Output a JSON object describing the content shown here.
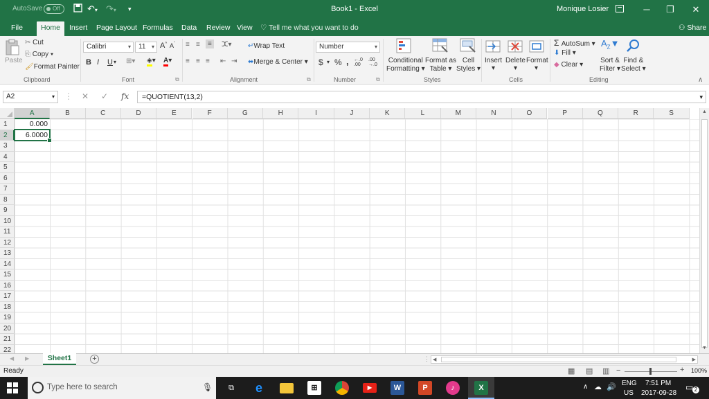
{
  "titlebar": {
    "autosave_label": "AutoSave",
    "autosave_state": "Off",
    "doc_title": "Book1  -  Excel",
    "user": "Monique Losier"
  },
  "tabs": [
    "File",
    "Home",
    "Insert",
    "Page Layout",
    "Formulas",
    "Data",
    "Review",
    "View"
  ],
  "active_tab": "Home",
  "tell_me": "Tell me what you want to do",
  "share": "Share",
  "ribbon": {
    "clipboard": {
      "paste": "Paste",
      "cut": "Cut",
      "copy": "Copy",
      "format_painter": "Format Painter",
      "label": "Clipboard"
    },
    "font": {
      "name": "Calibri",
      "size": "11",
      "bold": "B",
      "italic": "I",
      "underline": "U",
      "label": "Font"
    },
    "alignment": {
      "wrap": "Wrap Text",
      "merge": "Merge & Center",
      "label": "Alignment"
    },
    "number": {
      "format": "Number",
      "currency": "$",
      "percent": "%",
      "comma": ",",
      "label": "Number"
    },
    "styles": {
      "conditional": [
        "Conditional",
        "Formatting"
      ],
      "format_table": [
        "Format as",
        "Table"
      ],
      "cell_styles": [
        "Cell",
        "Styles"
      ],
      "label": "Styles"
    },
    "cells": {
      "insert": "Insert",
      "delete": "Delete",
      "format": "Format",
      "label": "Cells"
    },
    "editing": {
      "autosum": "AutoSum",
      "fill": "Fill",
      "clear": "Clear",
      "sort": [
        "Sort &",
        "Filter"
      ],
      "find": [
        "Find &",
        "Select"
      ],
      "label": "Editing"
    }
  },
  "formula_bar": {
    "name_box": "A2",
    "fx": "fx",
    "formula": "=QUOTIENT(13,2)"
  },
  "columns": [
    "A",
    "B",
    "C",
    "D",
    "E",
    "F",
    "G",
    "H",
    "I",
    "J",
    "K",
    "L",
    "M",
    "N",
    "O",
    "P",
    "Q",
    "R",
    "S"
  ],
  "rows": [
    "1",
    "2",
    "3",
    "4",
    "5",
    "6",
    "7",
    "8",
    "9",
    "10",
    "11",
    "12",
    "13",
    "14",
    "15",
    "16",
    "17",
    "18",
    "19",
    "20",
    "21",
    "22"
  ],
  "cells": {
    "A1": "0.000",
    "A2": "6.0000"
  },
  "sheet": {
    "name": "Sheet1"
  },
  "status": {
    "ready": "Ready",
    "zoom": "100%"
  },
  "taskbar": {
    "search_placeholder": "Type here to search",
    "lang": "ENG",
    "region": "US",
    "time": "7:51 PM",
    "date": "2017-09-28",
    "notifications": "2"
  },
  "colors": {
    "excel_green": "#217346",
    "taskbar": "#1c1c1c"
  }
}
